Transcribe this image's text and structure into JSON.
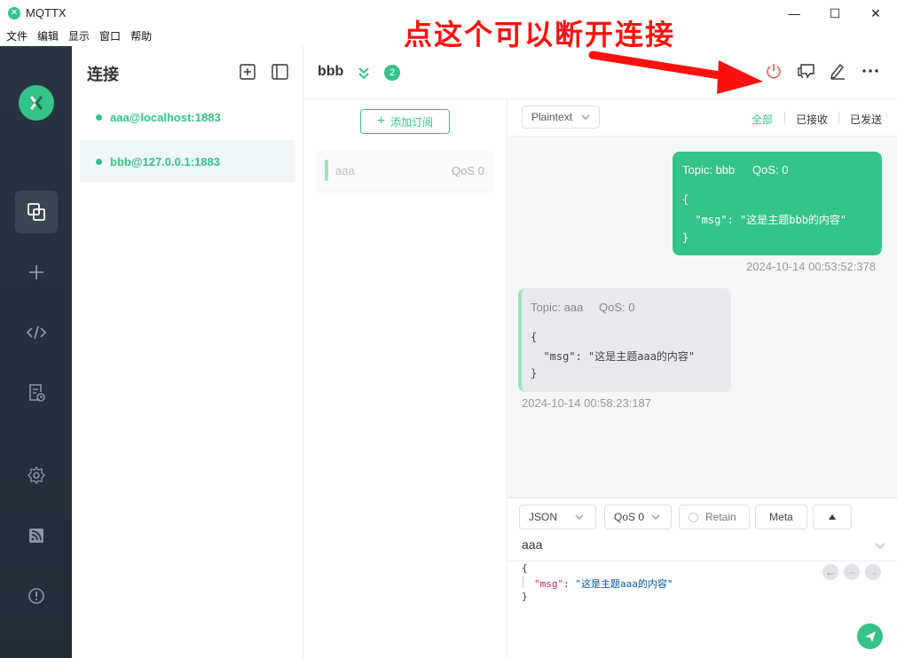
{
  "window": {
    "title": "MQTTX",
    "controls": {
      "minimize": "—",
      "maximize": "☐",
      "close": "✕"
    }
  },
  "menu": [
    "文件",
    "编辑",
    "显示",
    "窗口",
    "帮助"
  ],
  "annotation": {
    "text": "点这个可以断开连接",
    "color": "#ff1010"
  },
  "sidebar": {
    "items": [
      "connections-icon",
      "plus-icon",
      "code-icon",
      "log-icon",
      "settings-icon",
      "rss-icon",
      "info-icon"
    ]
  },
  "connections": {
    "title": "连接",
    "items": [
      {
        "label": "aaa@localhost:1883",
        "active": false
      },
      {
        "label": "bbb@127.0.0.1:1883",
        "active": true
      }
    ]
  },
  "header": {
    "name": "bbb",
    "badge": "2"
  },
  "subscriptions": {
    "add_label": "添加订阅",
    "items": [
      {
        "topic": "aaa",
        "qos": "QoS 0"
      }
    ]
  },
  "messages": {
    "format": "Plaintext",
    "filters": [
      "全部",
      "已接收",
      "已发送"
    ],
    "items": [
      {
        "direction": "out",
        "topic": "Topic: bbb",
        "qos": "QoS: 0",
        "payload_lines": [
          "{",
          "  \"msg\": \"这是主题bbb的内容\"",
          "}"
        ],
        "time": "2024-10-14 00:53:52:378"
      },
      {
        "direction": "in",
        "topic": "Topic: aaa",
        "qos": "QoS: 0",
        "payload_lines": [
          "{",
          "  \"msg\": \"这是主题aaa的内容\"",
          "}"
        ],
        "time": "2024-10-14 00:58:23:187"
      }
    ]
  },
  "composer": {
    "format": "JSON",
    "qos": "QoS 0",
    "retain": "Retain",
    "meta": "Meta",
    "topic": "aaa",
    "payload": {
      "open": "{",
      "key": "\"msg\"",
      "colon": ": ",
      "value": "\"这是主题aaa的内容\"",
      "close": "}"
    }
  },
  "colors": {
    "accent": "#34c388",
    "rail": "#283441",
    "power": "#e8595a"
  }
}
